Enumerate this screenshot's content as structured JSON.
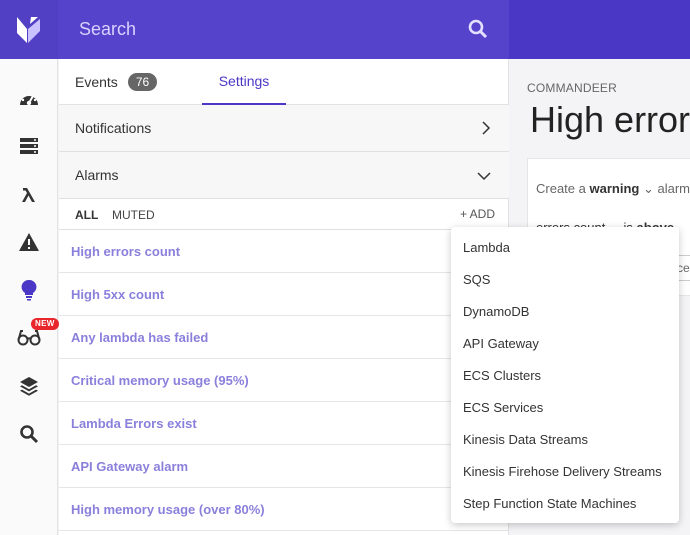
{
  "topbar": {
    "search_placeholder": "Search"
  },
  "rail": {
    "badge_new": "NEW",
    "icons": [
      "dashboard-icon",
      "servers-icon",
      "lambda-icon",
      "warning-icon",
      "lightbulb-icon",
      "glasses-icon",
      "layers-icon",
      "search-icon"
    ]
  },
  "tabs": [
    {
      "label": "Events",
      "count": "76"
    },
    {
      "label": "Settings"
    }
  ],
  "sections": {
    "notifications": "Notifications",
    "alarms": "Alarms"
  },
  "filters": {
    "all": "ALL",
    "muted": "MUTED",
    "add": "+ ADD"
  },
  "alarms": [
    "High errors count",
    "High 5xx count",
    "Any lambda has failed",
    "Critical memory usage (95%)",
    "Lambda Errors exist",
    "API Gateway alarm",
    "High memory usage (over 80%)"
  ],
  "content": {
    "breadcrumb": "COMMANDEER",
    "title": "High errors count",
    "create_prefix": "Create a",
    "severity": "warning",
    "create_suffix": "alarm",
    "metric": "errors count",
    "is": "is",
    "comparator": "above",
    "input_value": "ce"
  },
  "menu": [
    "Lambda",
    "SQS",
    "DynamoDB",
    "API Gateway",
    "ECS Clusters",
    "ECS Services",
    "Kinesis Data Streams",
    "Kinesis Firehose Delivery Streams",
    "Step Function State Machines"
  ],
  "colors": {
    "primary": "#4a37c6",
    "search_bg": "#5543cc",
    "alarm_link": "#8a80dc",
    "badge": "#e8262b"
  }
}
